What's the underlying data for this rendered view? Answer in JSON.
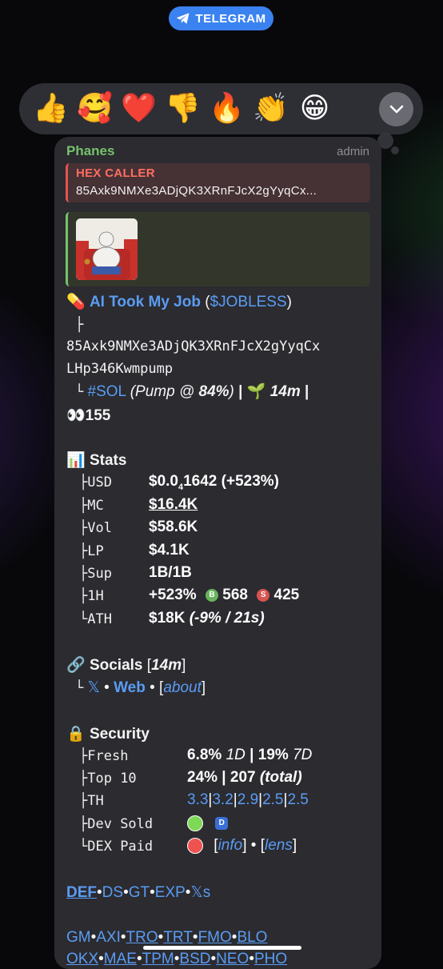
{
  "top_pill": {
    "label": "TELEGRAM",
    "color": "#3a82f0"
  },
  "reactions": [
    {
      "emoji": "👍",
      "name": "thumbs-up"
    },
    {
      "emoji": "🥰",
      "name": "smiling-hearts"
    },
    {
      "emoji": "❤️",
      "name": "red-heart"
    },
    {
      "emoji": "👎",
      "name": "thumbs-down"
    },
    {
      "emoji": "🔥",
      "name": "fire"
    },
    {
      "emoji": "👏",
      "name": "clapping"
    },
    {
      "emoji": "😁",
      "name": "grinning"
    }
  ],
  "message": {
    "sender": "Phanes",
    "role": "admin",
    "reply": {
      "name": "HEX CALLER",
      "text": "85Axk9NMXe3ADjQK3XRnFJcX2gYyqCx..."
    },
    "token": {
      "emoji": "💊",
      "name": "AI Took My Job",
      "open_paren": " (",
      "ticker": "$JOBLESS",
      "close_paren": ")",
      "tree_branch": "├",
      "address_line1": "85Axk9NMXe3ADjQK3XRnFJcX2gYyqCx",
      "address_line2": "LHp346Kwmpump",
      "tree_end": "└",
      "chain": "#SOL",
      "pump_pre": "(Pump @ ",
      "pump_pct": "84%",
      "pump_post": ")",
      "sep": " | ",
      "age_emoji": "🌱",
      "age": "14m",
      "views_emoji": "👀",
      "views": "155"
    },
    "stats": {
      "emoji": "📊",
      "title": "Stats",
      "rows": [
        {
          "prefix": "├",
          "label": "USD"
        },
        {
          "prefix": "├",
          "label": "MC"
        },
        {
          "prefix": "├",
          "label": "Vol"
        },
        {
          "prefix": "├",
          "label": "LP"
        },
        {
          "prefix": "├",
          "label": "Sup"
        },
        {
          "prefix": "├",
          "label": "1H"
        },
        {
          "prefix": "└",
          "label": "ATH"
        }
      ],
      "usd_a": "$0.0",
      "usd_sub": "4",
      "usd_b": "1642 (+523%)",
      "mc": "$16.4K",
      "vol": "$58.6K",
      "lp": "$4.1K",
      "sup": "1B/1B",
      "h1_change": "+523%",
      "buy_badge": "B",
      "buys": "568",
      "sell_badge": "S",
      "sells": "425",
      "ath_value": "$18K",
      "ath_note": "(-9% / 21s)"
    },
    "socials": {
      "emoji": "🔗",
      "title": "Socials",
      "age_open": " [",
      "age": "14m",
      "age_close": "]",
      "prefix": "└",
      "x_label": "𝕏",
      "dot": " • ",
      "web_label": "Web",
      "about_open": "[",
      "about_label": "about",
      "about_close": "]"
    },
    "security": {
      "emoji": "🔒",
      "title": "Security",
      "rows": [
        {
          "prefix": "├",
          "label": "Fresh"
        },
        {
          "prefix": "├",
          "label": "Top 10"
        },
        {
          "prefix": "├",
          "label": "TH"
        },
        {
          "prefix": "├",
          "label": "Dev Sold"
        },
        {
          "prefix": "└",
          "label": "DEX Paid"
        }
      ],
      "fresh_1d_pct": "6.8%",
      "fresh_1d_label": "1D",
      "fresh_sep": " | ",
      "fresh_7d_pct": "19%",
      "fresh_7d_label": "7D",
      "top10_pct": "24%",
      "top10_sep": " | ",
      "top10_count": "207",
      "top10_total": "(total)",
      "th_values": [
        "3.3",
        "3.2",
        "2.9",
        "2.5",
        "2.5"
      ],
      "th_sep": "|",
      "dev_badge": "D",
      "info_label": "info",
      "lens_label": "lens",
      "bracket_open": "[",
      "bracket_close": "]",
      "dot": " • ",
      "green_status": "#7ed957",
      "red_status": "#ef5350"
    },
    "links_row1": {
      "items": [
        "DEF",
        "DS",
        "GT",
        "EXP",
        "𝕏s"
      ],
      "sep": "•"
    },
    "links_row2": {
      "items": [
        "GM",
        "AXI",
        "TRO",
        "TRT",
        "FMO",
        "BLO"
      ],
      "sep": "•"
    },
    "links_row3": {
      "items": [
        "OKX",
        "MAE",
        "TPM",
        "BSD",
        "NEO",
        "PHO"
      ],
      "sep": "•"
    }
  },
  "colors": {
    "link": "#5b9cf3",
    "sender": "#76c26b",
    "reply_accent": "#e5544e",
    "bubble": "#2b2b30"
  }
}
